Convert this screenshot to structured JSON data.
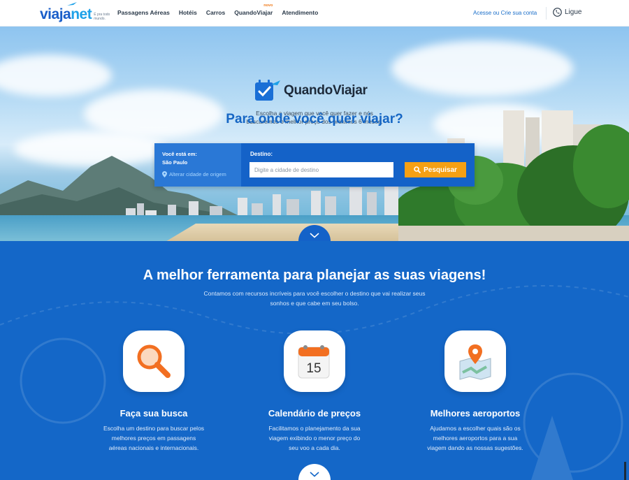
{
  "header": {
    "logo_main": "viaja",
    "logo_accent": "net",
    "logo_tagline": "É pra todo mundo.",
    "nav": [
      {
        "label": "Passagens Aéreas"
      },
      {
        "label": "Hotéis"
      },
      {
        "label": "Carros"
      },
      {
        "label": "QuandoViajar",
        "badge": "novo"
      },
      {
        "label": "Atendimento"
      }
    ],
    "login": "Acesse ou Crie sua conta",
    "phone_label": "Ligue"
  },
  "hero": {
    "brand": "QuandoViajar",
    "subtitle_line1": "Escolha a viagem que você quer fazer e nós",
    "subtitle_line2": "buscaremos o melhor preço dos próximos 6 meses.",
    "title": "Para onde você quer viajar?",
    "search": {
      "origin_label": "Você está em:",
      "origin_city": "São Paulo",
      "change_origin": "Alterar cidade de origem",
      "destination_label": "Destino:",
      "destination_placeholder": "Digite a cidade de destino",
      "destination_value": "",
      "button_label": "Pesquisar"
    }
  },
  "features": {
    "title": "A melhor ferramenta para planejar as suas viagens!",
    "subtitle_line1": "Contamos com recursos incríveis para você escolher o destino que vai realizar seus",
    "subtitle_line2": "sonhos e que cabe em seu bolso.",
    "items": [
      {
        "icon": "magnifier-icon",
        "title": "Faça sua busca",
        "line1": "Escolha um destino para buscar pelos",
        "line2": "melhores preços em passagens",
        "line3": "aéreas nacionais e internacionais."
      },
      {
        "icon": "calendar-icon",
        "calendar_day": "15",
        "title": "Calendário de preços",
        "line1": "Facilitamos o planejamento da sua",
        "line2": "viagem exibindo o menor preço do",
        "line3": "seu voo a cada dia."
      },
      {
        "icon": "map-pin-icon",
        "title": "Melhores aeroportos",
        "line1": "Ajudamos a escolher quais são os",
        "line2": "melhores aeroportos para a sua",
        "line3": "viagem dando as nossas sugestões."
      }
    ]
  },
  "colors": {
    "brand_blue": "#1467c8",
    "accent_orange": "#f5a014",
    "link_blue": "#1a6ec9"
  }
}
